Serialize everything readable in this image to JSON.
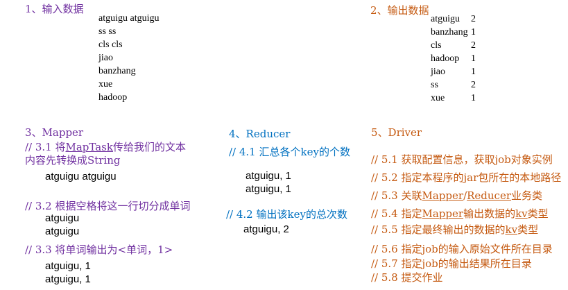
{
  "input": {
    "title": "1、输入数据",
    "lines": [
      "atguigu atguigu",
      "ss ss",
      "cls cls",
      "jiao",
      "banzhang",
      "xue",
      "hadoop"
    ]
  },
  "output": {
    "title": "2、输出数据",
    "rows": [
      {
        "key": "atguigu",
        "count": "2"
      },
      {
        "key": "banzhang",
        "count": "1"
      },
      {
        "key": "cls",
        "count": "2"
      },
      {
        "key": "hadoop",
        "count": "1"
      },
      {
        "key": "jiao",
        "count": "1"
      },
      {
        "key": "ss",
        "count": "2"
      },
      {
        "key": "xue",
        "count": "1"
      }
    ]
  },
  "mapper": {
    "title": "3、Mapper",
    "c31_pre": "//  3.1  将",
    "c31_link": "MapTask",
    "c31_post": "传给我们的文本",
    "c31_line2": "内容先转换成String",
    "code1": "atguigu atguigu",
    "c32": "// 3.2 根据空格将这一行切分成单词",
    "code2": [
      "atguigu",
      "atguigu"
    ],
    "c33": "// 3.3 将单词输出为<单词，1>",
    "code3": [
      "atguigu, 1",
      "atguigu, 1"
    ]
  },
  "reducer": {
    "title": "4、Reducer",
    "c41": "// 4.1 汇总各个key的个数",
    "code1": [
      "atguigu, 1",
      "atguigu, 1"
    ],
    "c42": "// 4.2  输出该key的总次数",
    "code2": "atguigu, 2"
  },
  "driver": {
    "title": "5、Driver",
    "c51": "// 5.1 获取配置信息，获取job对象实例",
    "c52": "// 5.2 指定本程序的jar包所在的本地路径",
    "c53_pre": "// 5.3 关联",
    "c53_link1": "Mapper",
    "c53_mid": "/",
    "c53_link2": "Reducer",
    "c53_post": "业务类",
    "c54_pre": "// 5.4 指定",
    "c54_link1": "Mapper",
    "c54_mid": "输出数据的",
    "c54_link2": "kv",
    "c54_post": "类型",
    "c55_pre": "// 5.5 指定最终输出的数据的",
    "c55_link": "kv",
    "c55_post": "类型",
    "c56": "// 5.6 指定job的输入原始文件所在目录",
    "c57": "// 5.7  指定job的输出结果所在目录",
    "c58": "// 5.8 提交作业"
  }
}
